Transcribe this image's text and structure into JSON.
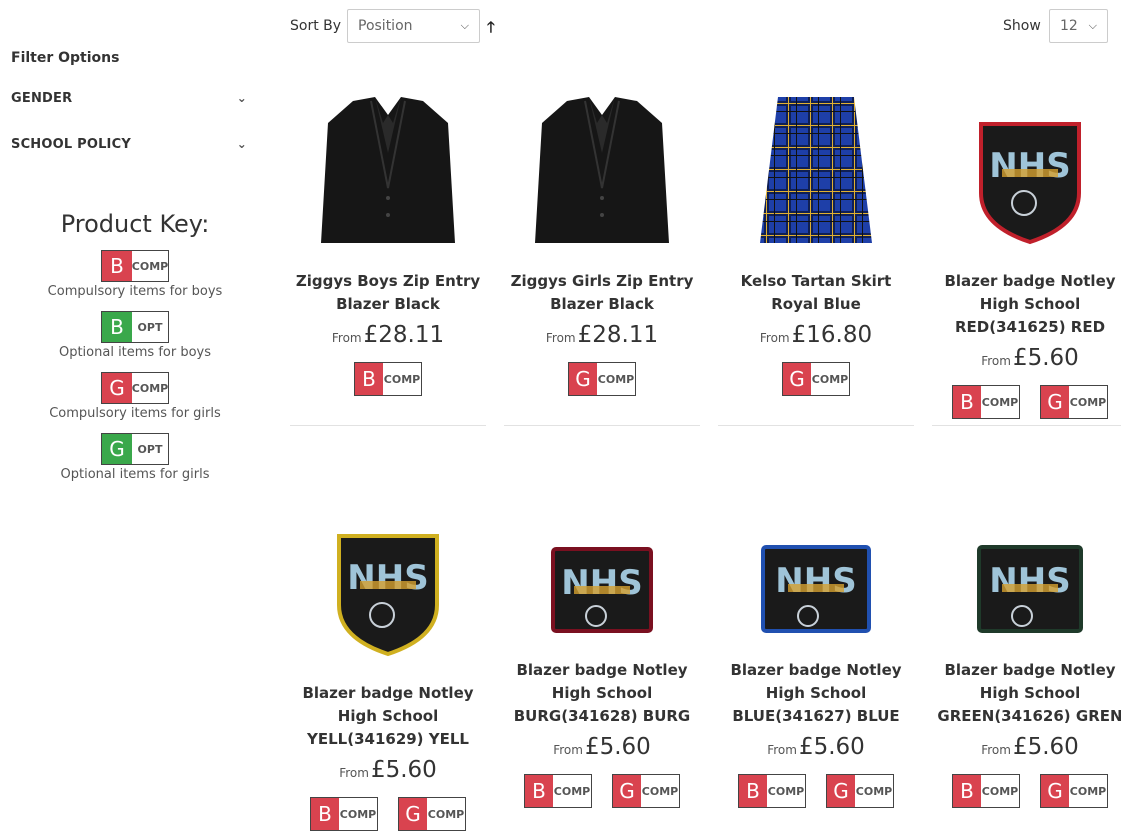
{
  "sidebar": {
    "filter_title": "Filter Options",
    "filters": [
      {
        "label": "GENDER"
      },
      {
        "label": "SCHOOL POLICY"
      }
    ],
    "key_title": "Product Key:",
    "key_items": [
      {
        "letter": "B",
        "tag": "COMP",
        "desc": "Compulsory items for boys",
        "color": "#d9434f"
      },
      {
        "letter": "B",
        "tag": "OPT",
        "desc": "Optional items for boys",
        "color": "#3aa84b"
      },
      {
        "letter": "G",
        "tag": "COMP",
        "desc": "Compulsory items for girls",
        "color": "#d9434f"
      },
      {
        "letter": "G",
        "tag": "OPT",
        "desc": "Optional items for girls",
        "color": "#3aa84b"
      }
    ]
  },
  "toolbar": {
    "sort_label": "Sort By",
    "sort_value": "Position",
    "show_label": "Show",
    "show_value": "12"
  },
  "products": [
    {
      "name": "Ziggys Boys Zip Entry Blazer Black",
      "from": "From",
      "price": "£28.11",
      "image": "black-blazer",
      "badges": [
        {
          "letter": "B",
          "tag": "COMP"
        }
      ]
    },
    {
      "name": "Ziggys Girls Zip Entry Blazer Black",
      "from": "From",
      "price": "£28.11",
      "image": "black-blazer",
      "badges": [
        {
          "letter": "G",
          "tag": "COMP"
        }
      ]
    },
    {
      "name": "Kelso Tartan Skirt Royal Blue",
      "from": "From",
      "price": "£16.80",
      "image": "tartan-skirt",
      "badges": [
        {
          "letter": "G",
          "tag": "COMP"
        }
      ]
    },
    {
      "name": "Blazer badge Notley High School RED(341625) RED",
      "from": "From",
      "price": "£5.60",
      "image": "badge-red",
      "badges": [
        {
          "letter": "B",
          "tag": "COMP"
        },
        {
          "letter": "G",
          "tag": "COMP"
        }
      ]
    },
    {
      "name": "Blazer badge Notley High School YELL(341629) YELL",
      "from": "From",
      "price": "£5.60",
      "image": "badge-yellow",
      "badges": [
        {
          "letter": "B",
          "tag": "COMP"
        },
        {
          "letter": "G",
          "tag": "COMP"
        }
      ]
    },
    {
      "name": "Blazer badge Notley High School BURG(341628) BURG",
      "from": "From",
      "price": "£5.60",
      "image": "badge-burg",
      "badges": [
        {
          "letter": "B",
          "tag": "COMP"
        },
        {
          "letter": "G",
          "tag": "COMP"
        }
      ]
    },
    {
      "name": "Blazer badge Notley High School BLUE(341627) BLUE",
      "from": "From",
      "price": "£5.60",
      "image": "badge-blue",
      "badges": [
        {
          "letter": "B",
          "tag": "COMP"
        },
        {
          "letter": "G",
          "tag": "COMP"
        }
      ]
    },
    {
      "name": "Blazer badge Notley High School GREEN(341626) GREN",
      "from": "From",
      "price": "£5.60",
      "image": "badge-green",
      "badges": [
        {
          "letter": "B",
          "tag": "COMP"
        },
        {
          "letter": "G",
          "tag": "COMP"
        }
      ]
    }
  ],
  "colors": {
    "comp": "#d9434f",
    "opt": "#3aa84b"
  }
}
